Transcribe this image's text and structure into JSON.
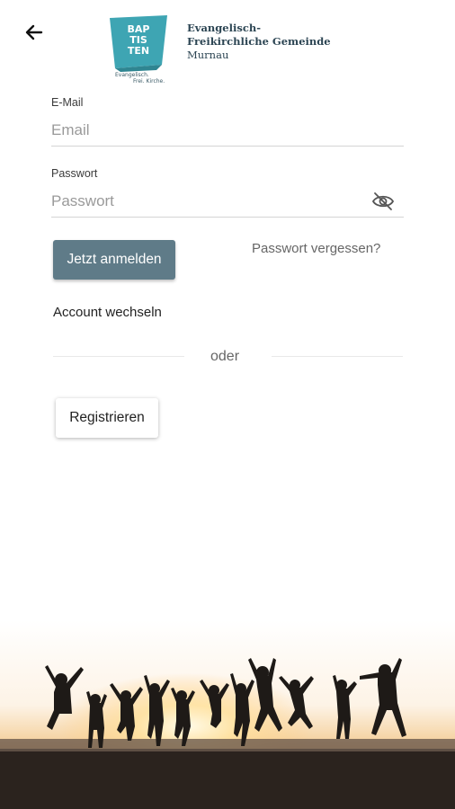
{
  "header": {
    "back_label": "Zurück",
    "logo": {
      "badge_line1": "BAP",
      "badge_line2": "TIS",
      "badge_line3": "TEN",
      "tagline_line1": "Evangelisch.",
      "tagline_line2": "Frei. Kirche."
    },
    "org_line1": "Evangelisch-",
    "org_line2": "Freikirchliche Gemeinde",
    "org_line3": "Murnau"
  },
  "form": {
    "email_label": "E-Mail",
    "email_placeholder": "Email",
    "email_value": "",
    "password_label": "Passwort",
    "password_placeholder": "Passwort",
    "password_value": ""
  },
  "actions": {
    "login_label": "Jetzt anmelden",
    "forgot_label": "Passwort vergessen?",
    "switch_account_label": "Account wechseln",
    "or_label": "oder",
    "register_label": "Registrieren"
  },
  "colors": {
    "primary_button": "#5f7b88",
    "logo_teal": "#3ea5b3",
    "org_text": "#2d4654"
  },
  "icons": {
    "back": "arrow-left-icon",
    "password_toggle": "eye-off-icon"
  }
}
